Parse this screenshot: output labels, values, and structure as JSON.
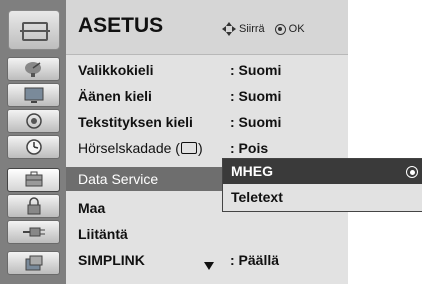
{
  "menu": {
    "title": "ASETUS",
    "hint_move": "Siirrä",
    "hint_ok": "OK",
    "section_icon": "setup-toolbox-icon",
    "items": [
      {
        "label": "Valikkokieli",
        "value": ": Suomi",
        "icon": "satellite-dish-icon"
      },
      {
        "label": "Äänen kieli",
        "value": ": Suomi",
        "icon": "tv-screen-icon"
      },
      {
        "label": "Tekstityksen kieli",
        "value": ": Suomi",
        "icon": "audio-speaker-icon"
      },
      {
        "label_before": "Hörselskadade (",
        "label_after": ")",
        "value": ": Pois",
        "icon": "clock-icon"
      },
      {
        "label": "Data Service",
        "value": "",
        "icon": "toolbox-icon",
        "highlighted": true
      },
      {
        "label": "Maa",
        "value": "",
        "icon": "lock-icon"
      },
      {
        "label": "Liitäntä",
        "value": "",
        "icon": "connector-plug-icon"
      },
      {
        "label": "SIMPLINK",
        "value": ": Päällä",
        "icon": "simplink-icon"
      }
    ]
  },
  "popup": {
    "options": [
      {
        "label": "MHEG",
        "selected": true
      },
      {
        "label": "Teletext",
        "selected": false
      }
    ]
  }
}
